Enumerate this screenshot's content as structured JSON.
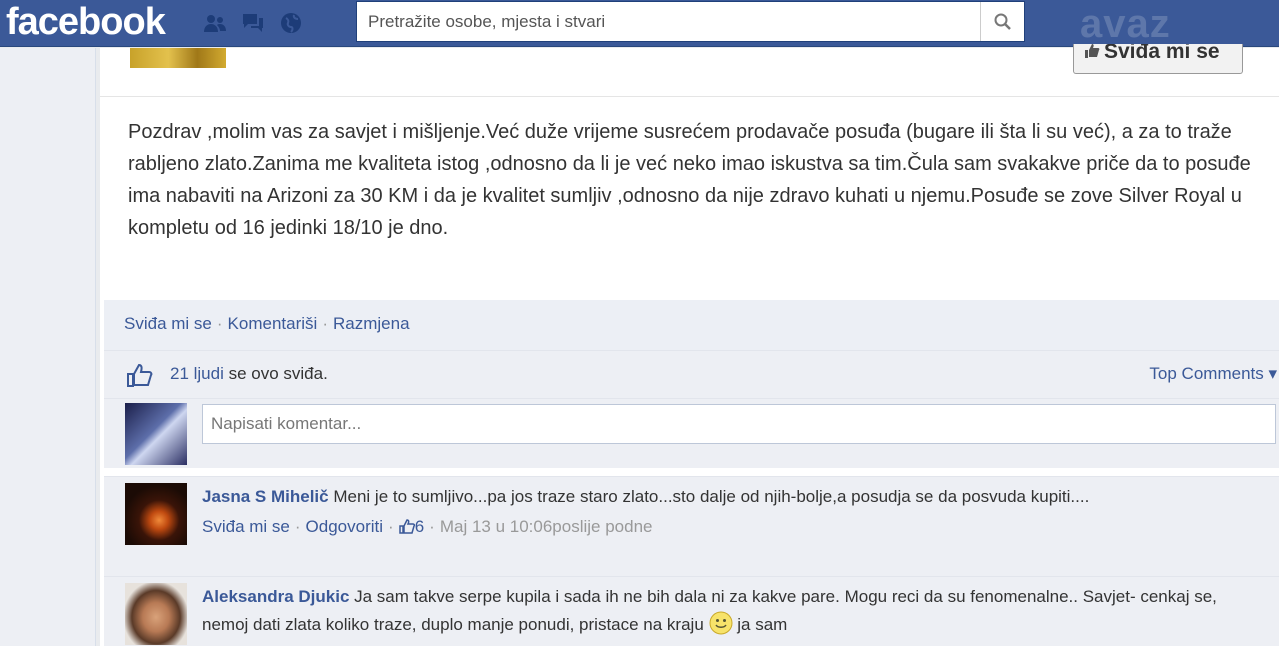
{
  "topbar": {
    "logo": "facebook",
    "search_placeholder": "Pretražite osobe, mjesta i stvari",
    "watermark": "avaz",
    "jewels": [
      "friend-requests-icon",
      "messages-icon",
      "notifications-icon"
    ]
  },
  "page_like_button": {
    "label": "Sviđa mi se"
  },
  "post": {
    "text": "Pozdrav ,molim vas za savjet i mišljenje.Već duže vrijeme susrećem prodavače posuđa (bugare ili šta li su već), a za to traže rabljeno zlato.Zanima me kvaliteta istog ,odnosno da li je već neko imao iskustva sa tim.Čula sam svakakve priče da to posuđe ima nabaviti na Arizoni za 30 KM i da je kvalitet sumljiv ,odnosno da nije zdravo kuhati u njemu.Posuđe se zove Silver Royal u kompletu od 16 jedinki 18/10 je dno."
  },
  "actions": {
    "like": "Sviđa mi se",
    "separator": "·",
    "comment": "Komentariši",
    "share": "Razmjena"
  },
  "likes": {
    "count_link": "21 ljudi",
    "suffix": " se ovo sviđa.",
    "top_comments": "Top Comments ▾"
  },
  "comment_input": {
    "placeholder": "Napisati komentar..."
  },
  "comments": [
    {
      "author": "Jasna S Mihelič",
      "text": " Meni je to sumljivo...pa jos traze staro zlato...sto dalje od njih-bolje,a posudja se da posvuda kupiti....",
      "like": "Sviđa mi se",
      "reply": "Odgovoriti",
      "likes_count": "6",
      "time": "Maj 13 u 10:06poslije podne"
    },
    {
      "author": "Aleksandra Djukic",
      "text_before": " Ja sam takve serpe kupila i sada ih ne bih dala ni za kakve pare. Mogu reci da su fenomenalne.. Savjet- cenkaj se, nemoj dati zlata koliko traze, duplo manje ponudi, pristace na kraju ",
      "text_after": " ja sam"
    }
  ],
  "colors": {
    "brand": "#3b5998",
    "link": "#3b5998",
    "panel": "#edeff4"
  }
}
